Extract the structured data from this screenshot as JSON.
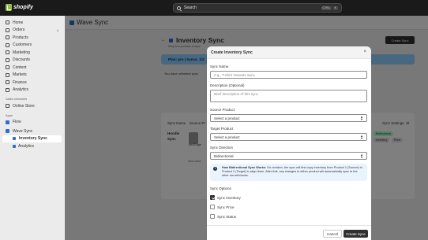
{
  "topbar": {
    "brand": "shopify",
    "search_label": "Search",
    "shortcut_keys": [
      "CTRL",
      "K"
    ]
  },
  "sidebar": {
    "items": [
      {
        "label": "Home",
        "icon": "home-icon"
      },
      {
        "label": "Orders",
        "icon": "orders-icon",
        "count": "4"
      },
      {
        "label": "Products",
        "icon": "tag-icon"
      },
      {
        "label": "Customers",
        "icon": "person-icon"
      },
      {
        "label": "Marketing",
        "icon": "target-icon"
      },
      {
        "label": "Discounts",
        "icon": "discount-icon"
      },
      {
        "label": "Content",
        "icon": "content-icon"
      },
      {
        "label": "Markets",
        "icon": "globe-icon"
      },
      {
        "label": "Finance",
        "icon": "bank-icon"
      },
      {
        "label": "Analytics",
        "icon": "chart-icon"
      }
    ],
    "sales_channels_heading": "Sales channels",
    "online_store": "Online Store",
    "apps_heading": "Apps",
    "flow": "Flow",
    "app_name": "Wave Sync",
    "app_sub_items": [
      "Inventory Sync",
      "Analytics"
    ]
  },
  "app_header": {
    "title": "Wave Sync"
  },
  "page": {
    "title": "Inventory Sync",
    "subtitle": "Keep two products in sync",
    "create_button": "Create Sync",
    "banner": "Plan: pro | Syncs: 1/2",
    "unlimited_text": "You have unlimited sync",
    "columns": [
      "Sync Name",
      "Source Pr",
      "Sync Settings",
      "St"
    ],
    "row": {
      "name_line1": "Hoodie",
      "name_line2": "Sync",
      "product_label": "Red Edge",
      "badges": [
        "Bidirectional",
        "Inventory",
        "Price"
      ]
    },
    "view_label": "View varia"
  },
  "modal": {
    "title": "Create Inventory Sync",
    "sync_name_label": "Sync Name",
    "sync_name_placeholder": "e.g., T-Shirt Variants Sync",
    "description_label": "Description (Optional)",
    "description_placeholder": "Brief description of this sync",
    "source_label": "Source Product",
    "source_value": "Select a product",
    "target_label": "Target Product",
    "target_value": "Select a product",
    "direction_label": "Sync Direction",
    "direction_value": "Bidirectional",
    "info_bold": "How Bidirectional Sync Works:",
    "info_text": " On creation, the sync will first copy inventory from Product 1 (Source) to Product 2 (Target) to align them. After that, any changes to either product will automatically sync to the other via webhooks.",
    "options_label": "Sync Options",
    "options": [
      {
        "label": "Sync Inventory",
        "checked": true
      },
      {
        "label": "Sync Price",
        "checked": false
      },
      {
        "label": "Sync Status",
        "checked": false
      }
    ],
    "cancel_label": "Cancel",
    "submit_label": "Create Sync"
  },
  "colors": {
    "topbar": "#1a1a1a",
    "banner": "#91d0ff",
    "primary_button": "#303030",
    "info_box": "#eaf4ff"
  }
}
